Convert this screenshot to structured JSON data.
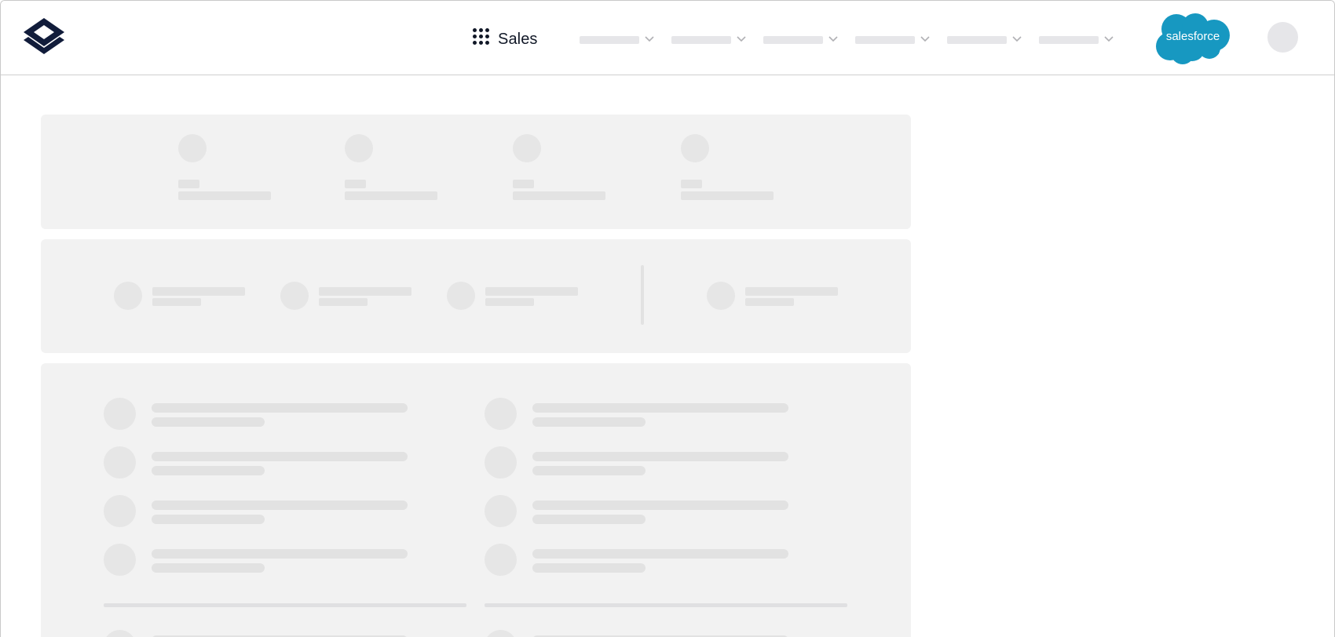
{
  "app": {
    "name": "Sales",
    "launcher_icon": "app-launcher-grid-icon",
    "brand_logo": "salesforce",
    "colors": {
      "brand_navy": "#111c3a",
      "salesforce_blue": "#1798c1",
      "skeleton": "#e6e6e6",
      "card_bg": "#f2f2f2"
    }
  },
  "nav": {
    "items": [
      {
        "id": "nav-1",
        "icon": "chevron-down-icon"
      },
      {
        "id": "nav-2",
        "icon": "chevron-down-icon"
      },
      {
        "id": "nav-3",
        "icon": "chevron-down-icon"
      },
      {
        "id": "nav-4",
        "icon": "chevron-down-icon"
      },
      {
        "id": "nav-5",
        "icon": "chevron-down-icon"
      },
      {
        "id": "nav-6",
        "icon": "chevron-down-icon"
      }
    ]
  },
  "sf_logo": {
    "text": "salesforce"
  },
  "loading_state": "skeleton"
}
